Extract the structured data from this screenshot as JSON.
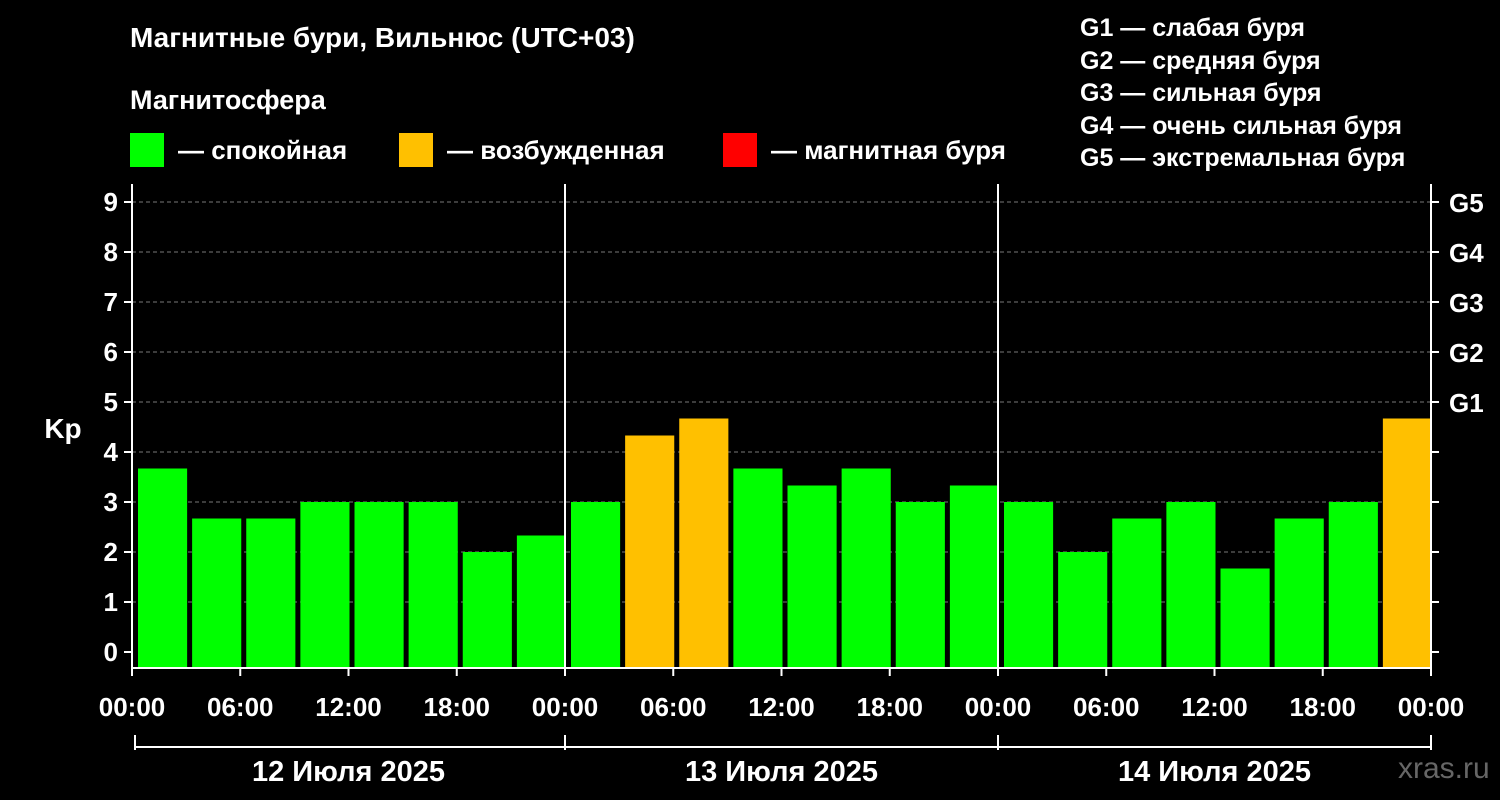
{
  "title": "Магнитные бури, Вильнюс (UTC+03)",
  "legend": {
    "heading": "Магнитосфера",
    "items": [
      {
        "label": "— спокойная",
        "color": "#00ff00"
      },
      {
        "label": "— возбужденная",
        "color": "#ffc000"
      },
      {
        "label": "— магнитная буря",
        "color": "#ff0000"
      }
    ]
  },
  "g_scale": [
    "G1 — слабая буря",
    "G2 — средняя буря",
    "G3 — сильная буря",
    "G4 — очень сильная буря",
    "G5 — экстремальная буря"
  ],
  "watermark": "xras.ru",
  "chart_data": {
    "type": "bar",
    "ylabel": "Kp",
    "ylim": [
      0,
      9
    ],
    "y_ticks": [
      0,
      1,
      2,
      3,
      4,
      5,
      6,
      7,
      8,
      9
    ],
    "right_ticks": [
      {
        "value": 5,
        "label": "G1"
      },
      {
        "value": 6,
        "label": "G2"
      },
      {
        "value": 7,
        "label": "G3"
      },
      {
        "value": 8,
        "label": "G4"
      },
      {
        "value": 9,
        "label": "G5"
      }
    ],
    "x_tick_labels": [
      "00:00",
      "06:00",
      "12:00",
      "18:00",
      "00:00",
      "06:00",
      "12:00",
      "18:00",
      "00:00",
      "06:00",
      "12:00",
      "18:00",
      "00:00"
    ],
    "days": [
      "12 Июля 2025",
      "13 Июля 2025",
      "14 Июля 2025"
    ],
    "interval_hours": 3,
    "values": [
      3.67,
      2.67,
      2.67,
      3.0,
      3.0,
      3.0,
      2.0,
      2.33,
      3.0,
      4.33,
      4.67,
      3.67,
      3.33,
      3.67,
      3.0,
      3.33,
      3.0,
      2.0,
      2.67,
      3.0,
      1.67,
      2.67,
      3.0,
      4.67
    ],
    "thresholds": {
      "quiet_below": 4,
      "storm_from": 5
    },
    "grid": true
  }
}
